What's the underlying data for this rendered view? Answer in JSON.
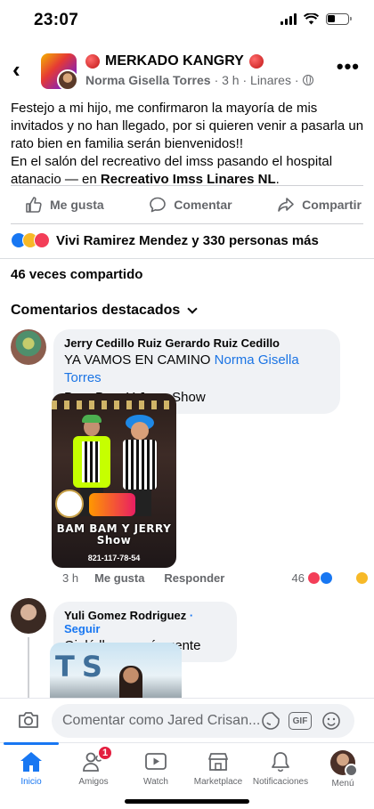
{
  "status_bar": {
    "time": "23:07"
  },
  "post": {
    "group_name": "MERKADO KANGRY",
    "author": "Norma Gisella Torres",
    "meta_suffix": "· 3 h · Linares ·",
    "text_line1": "Festejo a mi hijo, me confirmaron la mayoría de mis invitados y no han llegado, por si quieren venir a pasarla un rato bien en familia serán bienvenidos!!",
    "text_line2_prefix": "En el salón del recreativo del imss pasando el hospital atanacio — en ",
    "text_line2_place": "Recreativo Imss Linares NL",
    "text_line2_suffix": "."
  },
  "actions": {
    "like": "Me gusta",
    "comment": "Comentar",
    "share": "Compartir"
  },
  "reactions": {
    "summary": "Vivi Ramirez Mendez y 330 personas más"
  },
  "shares": {
    "label": "46 veces compartido"
  },
  "comments_header": {
    "label": "Comentarios destacados"
  },
  "comments": [
    {
      "name": "Jerry Cedillo Ruiz Gerardo Ruiz Cedillo",
      "text_prefix": "YA VAMOS EN CAMINO ",
      "mention": "Norma Gisella Torres",
      "text_line2": "Bam Bam Y Jerry Show",
      "image_title": "BAM BAM Y JERRY Show",
      "image_phone": "821-117-78-54",
      "time": "3 h",
      "like": "Me gusta",
      "reply": "Responder",
      "reaction_count": "46"
    },
    {
      "name": "Yuli Gomez Rodriguez",
      "follow": "· Seguir",
      "text": "Ojalá llegue más gente"
    }
  ],
  "comment_input": {
    "placeholder": "Comentar como Jared Crisan..."
  },
  "tabs": [
    {
      "label": "Inicio"
    },
    {
      "label": "Amigos",
      "badge": "1"
    },
    {
      "label": "Watch"
    },
    {
      "label": "Marketplace"
    },
    {
      "label": "Notificaciones"
    },
    {
      "label": "Menú"
    }
  ],
  "colors": {
    "accent": "#1877f2",
    "secondary_text": "#65676b",
    "bubble": "#f0f2f5",
    "badge": "#e41e3f"
  },
  "icons": [
    "back-arrow-icon",
    "more-icon",
    "globe-icon",
    "like-icon",
    "comment-icon",
    "share-icon",
    "camera-icon",
    "sticker-icon",
    "gif-icon",
    "emoji-icon",
    "home-icon",
    "friends-icon",
    "watch-icon",
    "marketplace-icon",
    "bell-icon"
  ]
}
